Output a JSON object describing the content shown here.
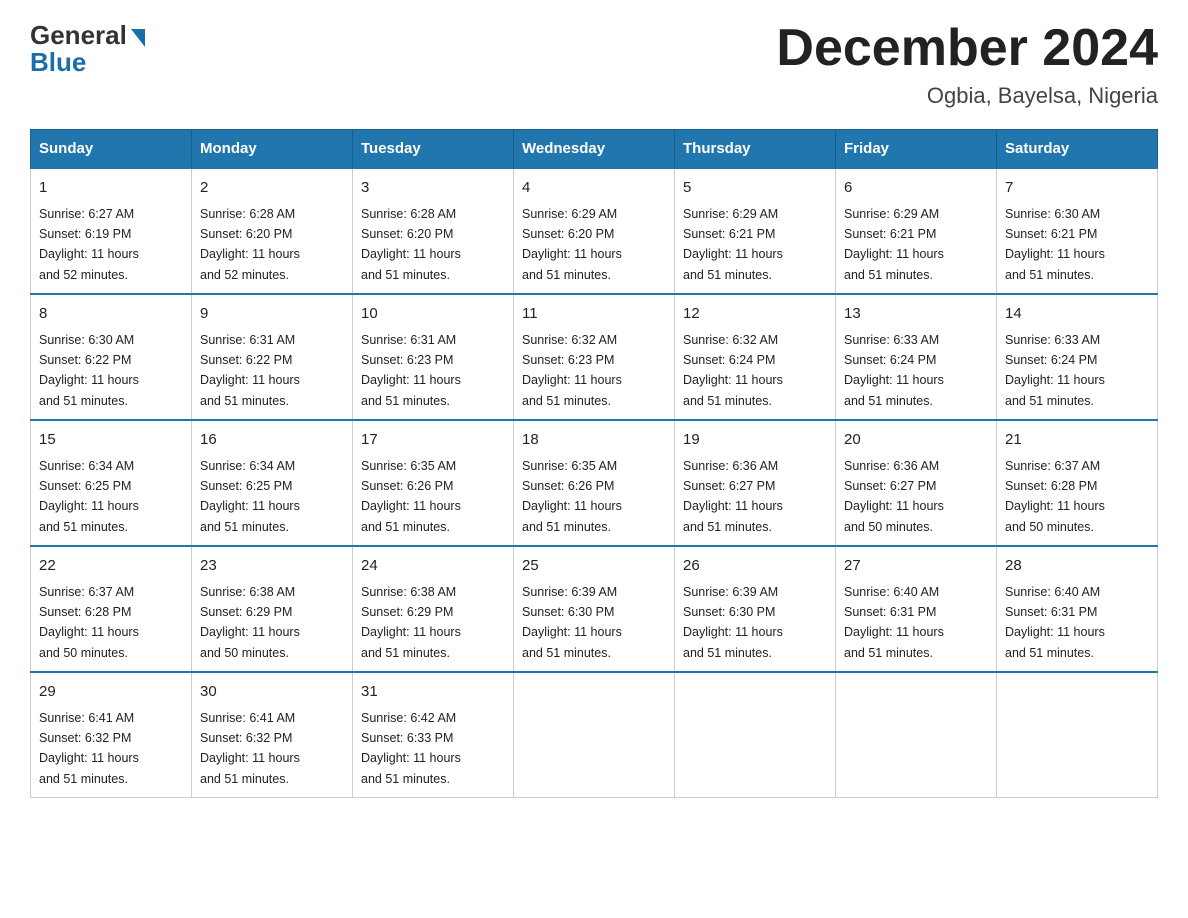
{
  "logo": {
    "general": "General",
    "blue": "Blue"
  },
  "header": {
    "title": "December 2024",
    "subtitle": "Ogbia, Bayelsa, Nigeria"
  },
  "weekdays": [
    "Sunday",
    "Monday",
    "Tuesday",
    "Wednesday",
    "Thursday",
    "Friday",
    "Saturday"
  ],
  "weeks": [
    [
      {
        "day": "1",
        "sunrise": "6:27 AM",
        "sunset": "6:19 PM",
        "daylight": "11 hours and 52 minutes."
      },
      {
        "day": "2",
        "sunrise": "6:28 AM",
        "sunset": "6:20 PM",
        "daylight": "11 hours and 52 minutes."
      },
      {
        "day": "3",
        "sunrise": "6:28 AM",
        "sunset": "6:20 PM",
        "daylight": "11 hours and 51 minutes."
      },
      {
        "day": "4",
        "sunrise": "6:29 AM",
        "sunset": "6:20 PM",
        "daylight": "11 hours and 51 minutes."
      },
      {
        "day": "5",
        "sunrise": "6:29 AM",
        "sunset": "6:21 PM",
        "daylight": "11 hours and 51 minutes."
      },
      {
        "day": "6",
        "sunrise": "6:29 AM",
        "sunset": "6:21 PM",
        "daylight": "11 hours and 51 minutes."
      },
      {
        "day": "7",
        "sunrise": "6:30 AM",
        "sunset": "6:21 PM",
        "daylight": "11 hours and 51 minutes."
      }
    ],
    [
      {
        "day": "8",
        "sunrise": "6:30 AM",
        "sunset": "6:22 PM",
        "daylight": "11 hours and 51 minutes."
      },
      {
        "day": "9",
        "sunrise": "6:31 AM",
        "sunset": "6:22 PM",
        "daylight": "11 hours and 51 minutes."
      },
      {
        "day": "10",
        "sunrise": "6:31 AM",
        "sunset": "6:23 PM",
        "daylight": "11 hours and 51 minutes."
      },
      {
        "day": "11",
        "sunrise": "6:32 AM",
        "sunset": "6:23 PM",
        "daylight": "11 hours and 51 minutes."
      },
      {
        "day": "12",
        "sunrise": "6:32 AM",
        "sunset": "6:24 PM",
        "daylight": "11 hours and 51 minutes."
      },
      {
        "day": "13",
        "sunrise": "6:33 AM",
        "sunset": "6:24 PM",
        "daylight": "11 hours and 51 minutes."
      },
      {
        "day": "14",
        "sunrise": "6:33 AM",
        "sunset": "6:24 PM",
        "daylight": "11 hours and 51 minutes."
      }
    ],
    [
      {
        "day": "15",
        "sunrise": "6:34 AM",
        "sunset": "6:25 PM",
        "daylight": "11 hours and 51 minutes."
      },
      {
        "day": "16",
        "sunrise": "6:34 AM",
        "sunset": "6:25 PM",
        "daylight": "11 hours and 51 minutes."
      },
      {
        "day": "17",
        "sunrise": "6:35 AM",
        "sunset": "6:26 PM",
        "daylight": "11 hours and 51 minutes."
      },
      {
        "day": "18",
        "sunrise": "6:35 AM",
        "sunset": "6:26 PM",
        "daylight": "11 hours and 51 minutes."
      },
      {
        "day": "19",
        "sunrise": "6:36 AM",
        "sunset": "6:27 PM",
        "daylight": "11 hours and 51 minutes."
      },
      {
        "day": "20",
        "sunrise": "6:36 AM",
        "sunset": "6:27 PM",
        "daylight": "11 hours and 50 minutes."
      },
      {
        "day": "21",
        "sunrise": "6:37 AM",
        "sunset": "6:28 PM",
        "daylight": "11 hours and 50 minutes."
      }
    ],
    [
      {
        "day": "22",
        "sunrise": "6:37 AM",
        "sunset": "6:28 PM",
        "daylight": "11 hours and 50 minutes."
      },
      {
        "day": "23",
        "sunrise": "6:38 AM",
        "sunset": "6:29 PM",
        "daylight": "11 hours and 50 minutes."
      },
      {
        "day": "24",
        "sunrise": "6:38 AM",
        "sunset": "6:29 PM",
        "daylight": "11 hours and 51 minutes."
      },
      {
        "day": "25",
        "sunrise": "6:39 AM",
        "sunset": "6:30 PM",
        "daylight": "11 hours and 51 minutes."
      },
      {
        "day": "26",
        "sunrise": "6:39 AM",
        "sunset": "6:30 PM",
        "daylight": "11 hours and 51 minutes."
      },
      {
        "day": "27",
        "sunrise": "6:40 AM",
        "sunset": "6:31 PM",
        "daylight": "11 hours and 51 minutes."
      },
      {
        "day": "28",
        "sunrise": "6:40 AM",
        "sunset": "6:31 PM",
        "daylight": "11 hours and 51 minutes."
      }
    ],
    [
      {
        "day": "29",
        "sunrise": "6:41 AM",
        "sunset": "6:32 PM",
        "daylight": "11 hours and 51 minutes."
      },
      {
        "day": "30",
        "sunrise": "6:41 AM",
        "sunset": "6:32 PM",
        "daylight": "11 hours and 51 minutes."
      },
      {
        "day": "31",
        "sunrise": "6:42 AM",
        "sunset": "6:33 PM",
        "daylight": "11 hours and 51 minutes."
      },
      null,
      null,
      null,
      null
    ]
  ],
  "labels": {
    "sunrise": "Sunrise:",
    "sunset": "Sunset:",
    "daylight": "Daylight:"
  }
}
